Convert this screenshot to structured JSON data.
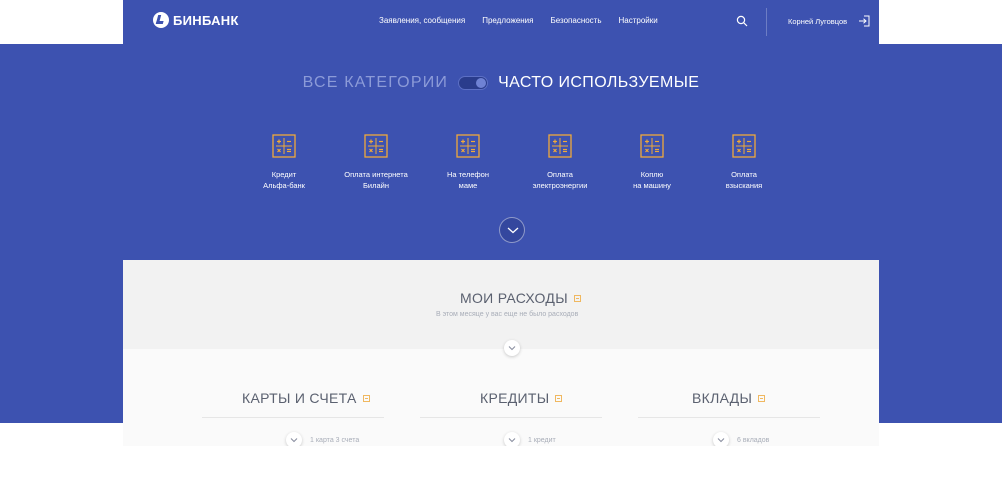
{
  "colors": {
    "brand_blue": "#3d52b0",
    "accent_orange": "#f0a93a",
    "text_gray": "#5b6170"
  },
  "header": {
    "logo_text": "БИНБАНК",
    "nav": [
      "Заявления, сообщения",
      "Предложения",
      "Безопасность",
      "Настройки"
    ],
    "user_name": "Корней Луговцов"
  },
  "hero": {
    "toggle_left": "ВСЕ КАТЕГОРИИ",
    "toggle_right": "ЧАСТО ИСПОЛЬЗУЕМЫЕ",
    "toggle_state": "right",
    "tiles": [
      {
        "label": "Кредит\nАльфа-банк",
        "icon": "calculator-icon"
      },
      {
        "label": "Оплата интернета\nБилайн",
        "icon": "calculator-icon"
      },
      {
        "label": "На телефон\nмаме",
        "icon": "calculator-icon"
      },
      {
        "label": "Оплата\nэлектроэнергии",
        "icon": "calculator-icon"
      },
      {
        "label": "Коплю\nна машину",
        "icon": "calculator-icon"
      },
      {
        "label": "Оплата\nвзыскания",
        "icon": "calculator-icon"
      }
    ]
  },
  "expenses": {
    "title": "МОИ РАСХОДЫ",
    "subtitle": "В этом месяце у вас еще не было расходов"
  },
  "accounts": [
    {
      "title": "КАРТЫ И СЧЕТА",
      "summary": "1 карта 3 счета"
    },
    {
      "title": "КРЕДИТЫ",
      "summary": "1 кредит"
    },
    {
      "title": "ВКЛАДЫ",
      "summary": "6 вкладов"
    }
  ]
}
